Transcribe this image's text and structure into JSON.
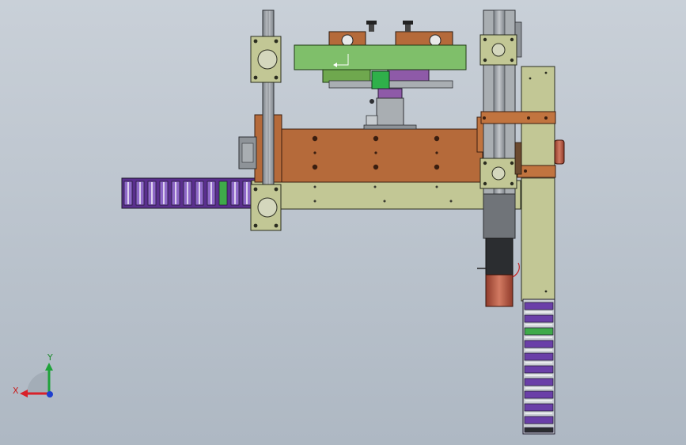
{
  "triad": {
    "x_label": "X",
    "y_label": "Y",
    "x_color": "#d8212a",
    "y_color": "#1fa23a",
    "z_color": "#1e3fcf"
  },
  "colors": {
    "background_top": "#c9d0d8",
    "background_bottom": "#aeb8c3",
    "olive_plate": "#c2c795",
    "copper_plate": "#b56a3a",
    "green_plate": "#7fbf6a",
    "rail_gray": "#9aa0a6",
    "cable_purple": "#6a3fa8",
    "motor_red": "#b8523e",
    "dark_gray": "#4a4d52"
  }
}
